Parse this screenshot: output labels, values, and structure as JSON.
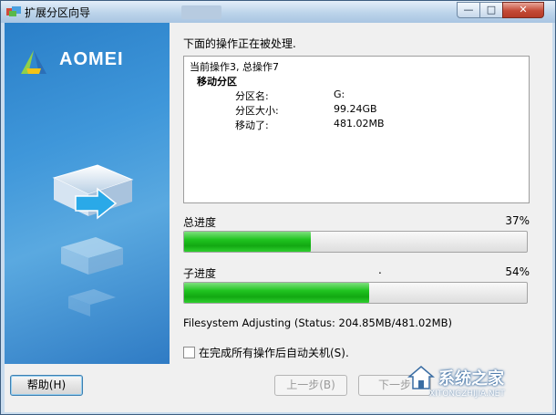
{
  "window": {
    "title": "扩展分区向导",
    "controls": {
      "minimize": "—",
      "maximize": "□",
      "close": "✕"
    }
  },
  "brand": {
    "name": "AOMEI"
  },
  "main": {
    "heading": "下面的操作正在被处理.",
    "log": {
      "current_line": "当前操作3, 总操作7",
      "section": "移动分区",
      "rows": [
        {
          "key": "分区名:",
          "value": "G:"
        },
        {
          "key": "分区大小:",
          "value": "99.24GB"
        },
        {
          "key": "移动了:",
          "value": "481.02MB"
        }
      ]
    },
    "total_progress": {
      "label": "总进度",
      "percent_text": "37%",
      "fraction": 0.37
    },
    "sub_progress": {
      "label": "子进度",
      "dot": ".",
      "percent_text": "54%",
      "fraction": 0.54
    },
    "status_line": "Filesystem Adjusting (Status: 204.85MB/481.02MB)",
    "shutdown_label": "在完成所有操作后自动关机(S).",
    "shutdown_checked": false
  },
  "footer": {
    "help_label": "帮助(H)",
    "prev_label": "上一步(B)",
    "next_label": "下一步"
  },
  "watermark": {
    "title": "系统之家",
    "url": "XITONGZHIJIA.NET"
  },
  "colors": {
    "progress_green": "#1fc31f",
    "panel_blue": "#3f97da",
    "titlebar": "#bcd4ea"
  }
}
